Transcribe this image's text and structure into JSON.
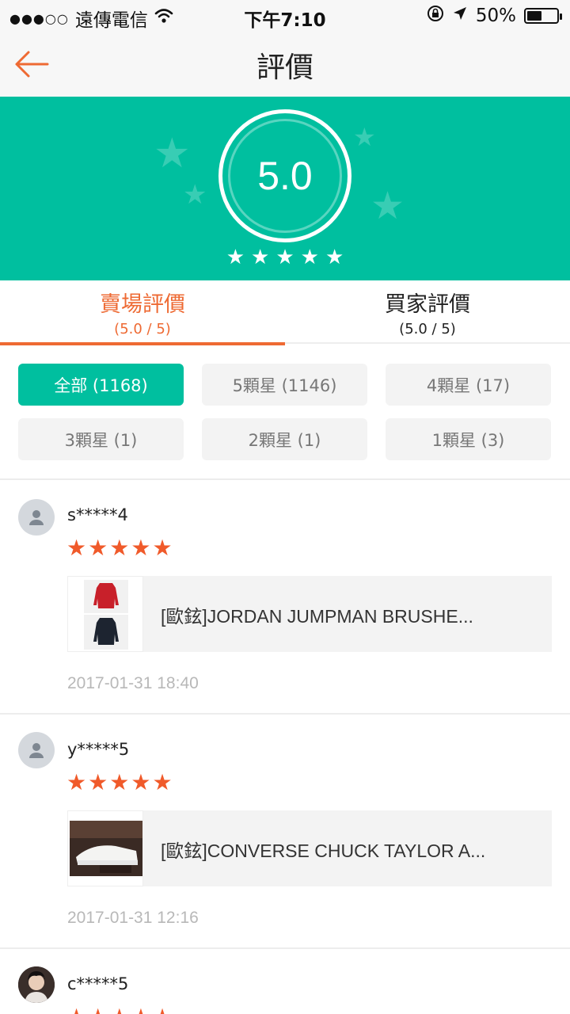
{
  "status_bar": {
    "signal": "●●●○○",
    "carrier": "遠傳電信",
    "time": "下午7:10",
    "battery_percent": "50%",
    "battery_level": 0.5
  },
  "nav": {
    "title": "評價",
    "back_icon": "arrow-left-icon"
  },
  "summary": {
    "score": "5.0",
    "stars": 5
  },
  "tabs": [
    {
      "label": "賣場評價",
      "sub": "(5.0 / 5)",
      "active": true
    },
    {
      "label": "買家評價",
      "sub": "(5.0 / 5)",
      "active": false
    }
  ],
  "filters": [
    {
      "label": "全部 (1168)",
      "active": true
    },
    {
      "label": "5顆星 (1146)",
      "active": false
    },
    {
      "label": "4顆星 (17)",
      "active": false
    },
    {
      "label": "3顆星 (1)",
      "active": false
    },
    {
      "label": "2顆星 (1)",
      "active": false
    },
    {
      "label": "1顆星 (3)",
      "active": false
    }
  ],
  "reviews": [
    {
      "user": "s*****4",
      "rating": 5,
      "product": "[歐鉉]JORDAN JUMPMAN BRUSHE...",
      "time": "2017-01-31 18:40"
    },
    {
      "user": "y*****5",
      "rating": 5,
      "product": "[歐鉉]CONVERSE CHUCK TAYLOR A...",
      "time": "2017-01-31 12:16"
    },
    {
      "user": "c*****5",
      "rating": 5
    }
  ],
  "colors": {
    "accent_green": "#00bf9f",
    "accent_orange": "#ee6a33",
    "star_orange": "#f05a2a"
  }
}
